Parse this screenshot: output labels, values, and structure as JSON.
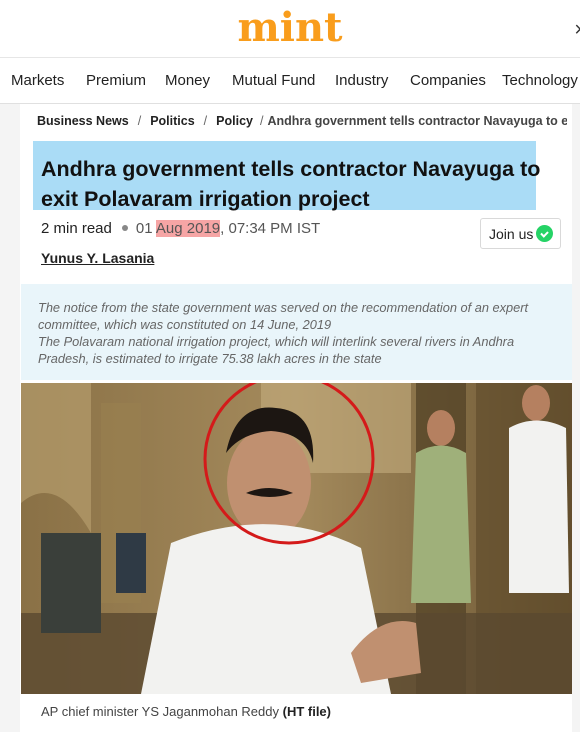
{
  "header": {
    "logo": "mint",
    "close_symbol": "×"
  },
  "nav": {
    "items": [
      "Markets",
      "Premium",
      "Money",
      "Mutual Fund",
      "Industry",
      "Companies",
      "Technology"
    ]
  },
  "breadcrumb": {
    "items": [
      "Business News",
      "Politics",
      "Policy"
    ],
    "current": "Andhra government tells contractor Navayuga to exit ..."
  },
  "article": {
    "headline": "Andhra government tells contractor Navayuga to exit Polavaram irrigation project",
    "read_time": "2 min read",
    "date_day": "01",
    "date_month_year": "Aug 2019",
    "date_time": ", 07:34 PM IST",
    "author": "Yunus Y. Lasania",
    "join_label": "Join us",
    "summary": [
      "The notice from the state government was served on the recommendation of an expert committee, which was constituted on 14 June, 2019",
      "The Polavaram national irrigation project, which will interlink several rivers in Andhra Pradesh, is estimated to irrigate 75.38 lakh acres in the state"
    ],
    "caption_text": "AP chief minister YS Jaganmohan Reddy ",
    "caption_credit": "(HT file)"
  },
  "colors": {
    "brand": "#f99d1c",
    "headline_highlight": "#aadcf6",
    "date_highlight": "#f6a5a5",
    "summary_bg": "#e9f5fa",
    "annotation_circle": "#d41a1a"
  },
  "icons": {
    "join": "whatsapp-icon",
    "close": "close-icon"
  }
}
